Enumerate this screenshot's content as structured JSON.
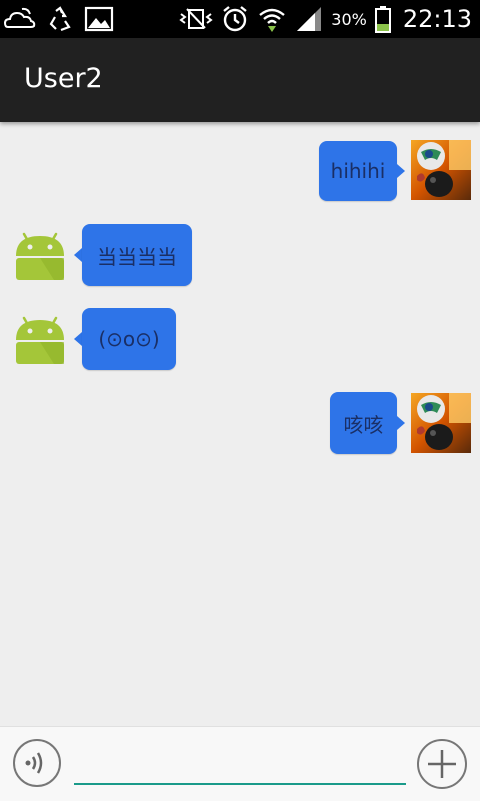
{
  "status_bar": {
    "battery_percent": "30%",
    "time": "22:13",
    "icons": [
      "cloud-icon",
      "recycle-icon",
      "image-icon",
      "vibrate-icon",
      "alarm-icon",
      "wifi-icon",
      "signal-icon",
      "battery-icon"
    ]
  },
  "action_bar": {
    "title": "User2"
  },
  "messages": [
    {
      "side": "right",
      "text": "hihihi",
      "avatar": "photo-avatar"
    },
    {
      "side": "left",
      "text": "当当当当",
      "avatar": "android-icon"
    },
    {
      "side": "left",
      "text": "(⊙o⊙)",
      "avatar": "android-icon"
    },
    {
      "side": "right",
      "text": "咳咳",
      "avatar": "photo-avatar"
    }
  ],
  "input_bar": {
    "value": "",
    "placeholder": "",
    "voice_icon": "voice-icon",
    "add_icon": "plus-icon"
  },
  "colors": {
    "bubble": "#2e74e8",
    "action_bar": "#212121",
    "background": "#eeeeee",
    "android_green": "#a4c639",
    "input_underline": "#1a9a8a"
  }
}
